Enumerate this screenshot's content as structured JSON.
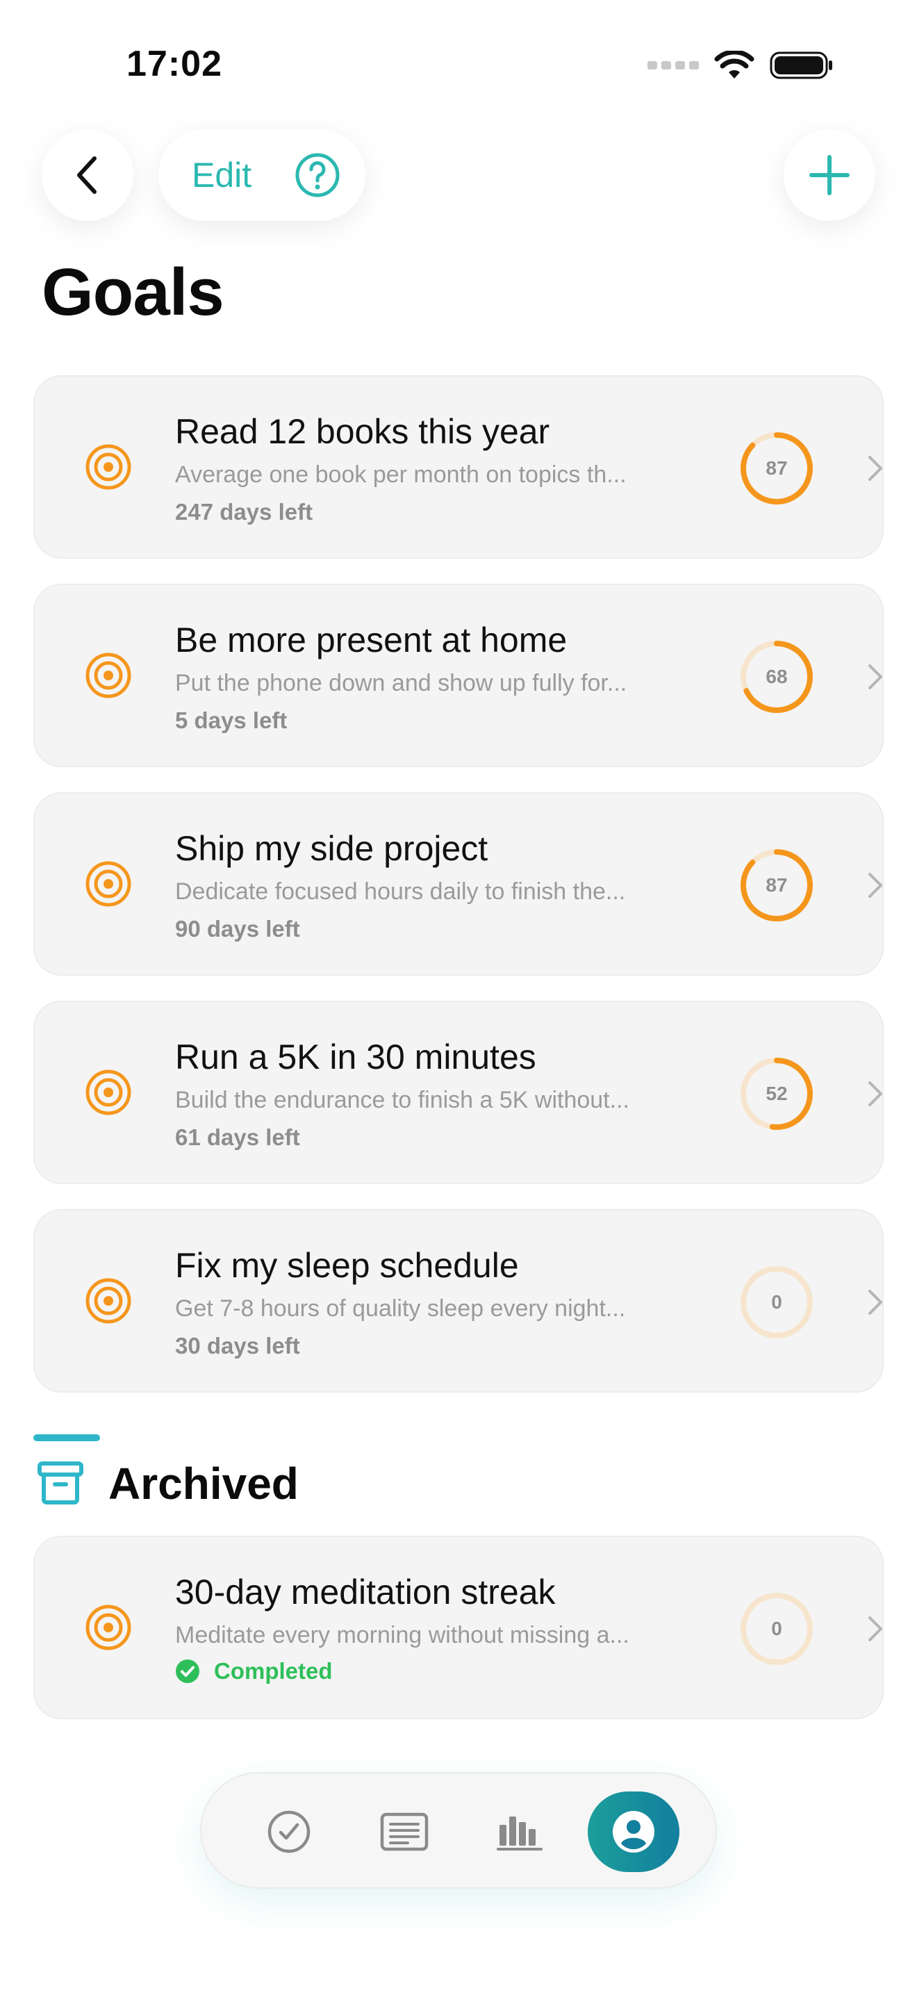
{
  "status_bar": {
    "time": "17:02"
  },
  "nav": {
    "edit_label": "Edit"
  },
  "page": {
    "title": "Goals"
  },
  "colors": {
    "accent": "#2bb8b0",
    "goal_orange": "#f5961c",
    "ring_track": "#f6e5cc",
    "completed_green": "#2fbf5a",
    "archive_teal": "#2fb6c9"
  },
  "goals": [
    {
      "title": "Read 12 books this year",
      "description": "Average one book per month on topics th...",
      "days_left": "247 days left",
      "progress": 87,
      "progress_label": "87"
    },
    {
      "title": "Be more present at home",
      "description": "Put the phone down and show up fully for...",
      "days_left": "5 days left",
      "progress": 68,
      "progress_label": "68"
    },
    {
      "title": "Ship my side project",
      "description": "Dedicate focused hours daily to finish the...",
      "days_left": "90 days left",
      "progress": 87,
      "progress_label": "87"
    },
    {
      "title": "Run a 5K in 30 minutes",
      "description": "Build the endurance to finish a 5K without...",
      "days_left": "61 days left",
      "progress": 52,
      "progress_label": "52"
    },
    {
      "title": "Fix my sleep schedule",
      "description": "Get 7-8 hours of quality sleep every night...",
      "days_left": "30 days left",
      "progress": 0,
      "progress_label": "0"
    }
  ],
  "archived": {
    "title": "Archived",
    "items": [
      {
        "title": "30-day meditation streak",
        "description": "Meditate every morning without missing a...",
        "status": "Completed",
        "progress": 0,
        "progress_label": "0"
      }
    ]
  },
  "tabbar": {
    "items": [
      "checkmark-circle-icon",
      "list-icon",
      "bar-chart-icon",
      "profile-icon"
    ],
    "active_index": 3
  }
}
